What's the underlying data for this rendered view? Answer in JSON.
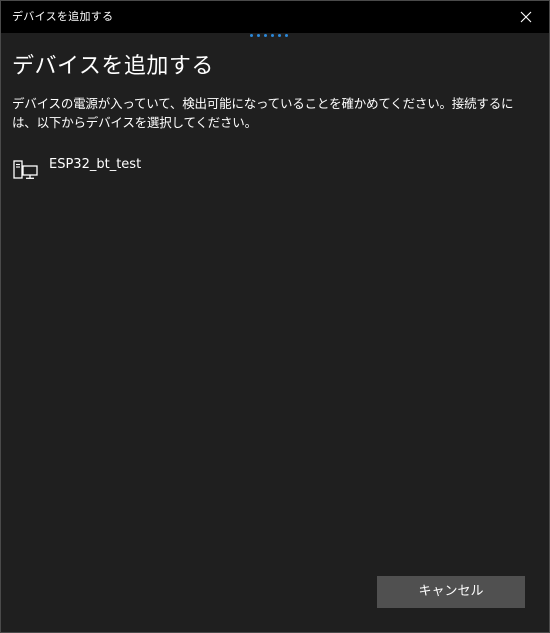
{
  "window": {
    "title": "デバイスを追加する",
    "close_icon": "close-icon"
  },
  "progress": {
    "dot_count": 6,
    "color": "#2b88d8"
  },
  "main": {
    "heading": "デバイスを追加する",
    "instructions": "デバイスの電源が入っていて、検出可能になっていることを確かめてください。接続するには、以下からデバイスを選択してください。",
    "devices": [
      {
        "name": "ESP32_bt_test",
        "icon": "computer-device-icon"
      }
    ]
  },
  "footer": {
    "cancel_label": "キャンセル"
  },
  "colors": {
    "window_background": "#1f1f1f",
    "titlebar_background": "#000000",
    "button_background": "#505050",
    "text": "#ffffff",
    "accent": "#2b88d8"
  }
}
